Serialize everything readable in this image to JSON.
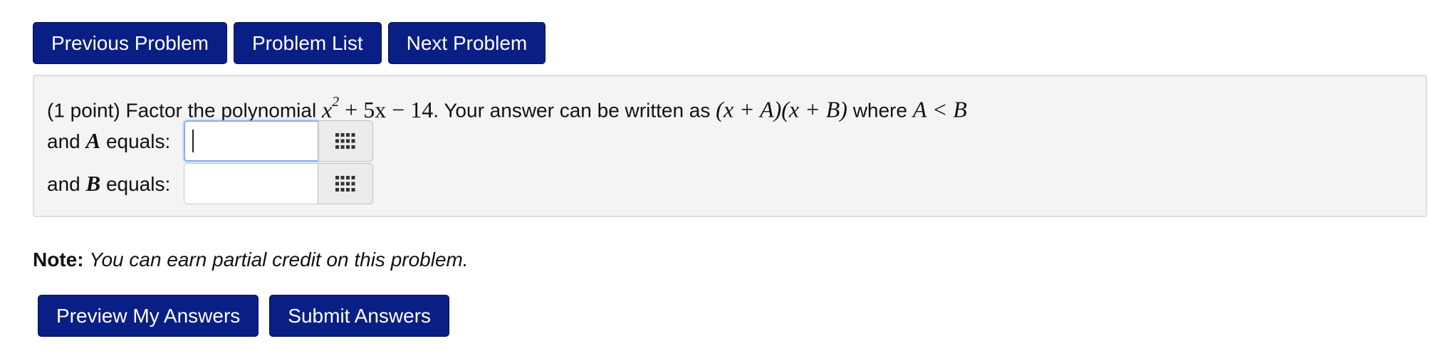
{
  "nav": {
    "previous_label": "Previous Problem",
    "list_label": "Problem List",
    "next_label": "Next Problem"
  },
  "problem": {
    "points": "(1 point)",
    "text_before": "Factor the polynomial",
    "poly_x": "x",
    "poly_exp": "2",
    "poly_rest": "+ 5x − 14",
    "text_middle": ". Your answer can be written as",
    "form_1": "(x + A)(x + B)",
    "text_where": "where",
    "condition": "A < B"
  },
  "answers": [
    {
      "prefix": "and",
      "var": "A",
      "suffix": "equals:",
      "value": "",
      "focused": true,
      "icon": "keyboard-grid-icon"
    },
    {
      "prefix": "and",
      "var": "B",
      "suffix": "equals:",
      "value": "",
      "focused": false,
      "icon": "keyboard-grid-icon"
    }
  ],
  "note": {
    "lead": "Note:",
    "message": "You can earn partial credit on this problem."
  },
  "actions": {
    "preview_label": "Preview My Answers",
    "submit_label": "Submit Answers"
  },
  "colors": {
    "button_bg": "#0a1f85",
    "panel_bg": "#f4f4f4",
    "focus_border": "#86b0ee"
  }
}
